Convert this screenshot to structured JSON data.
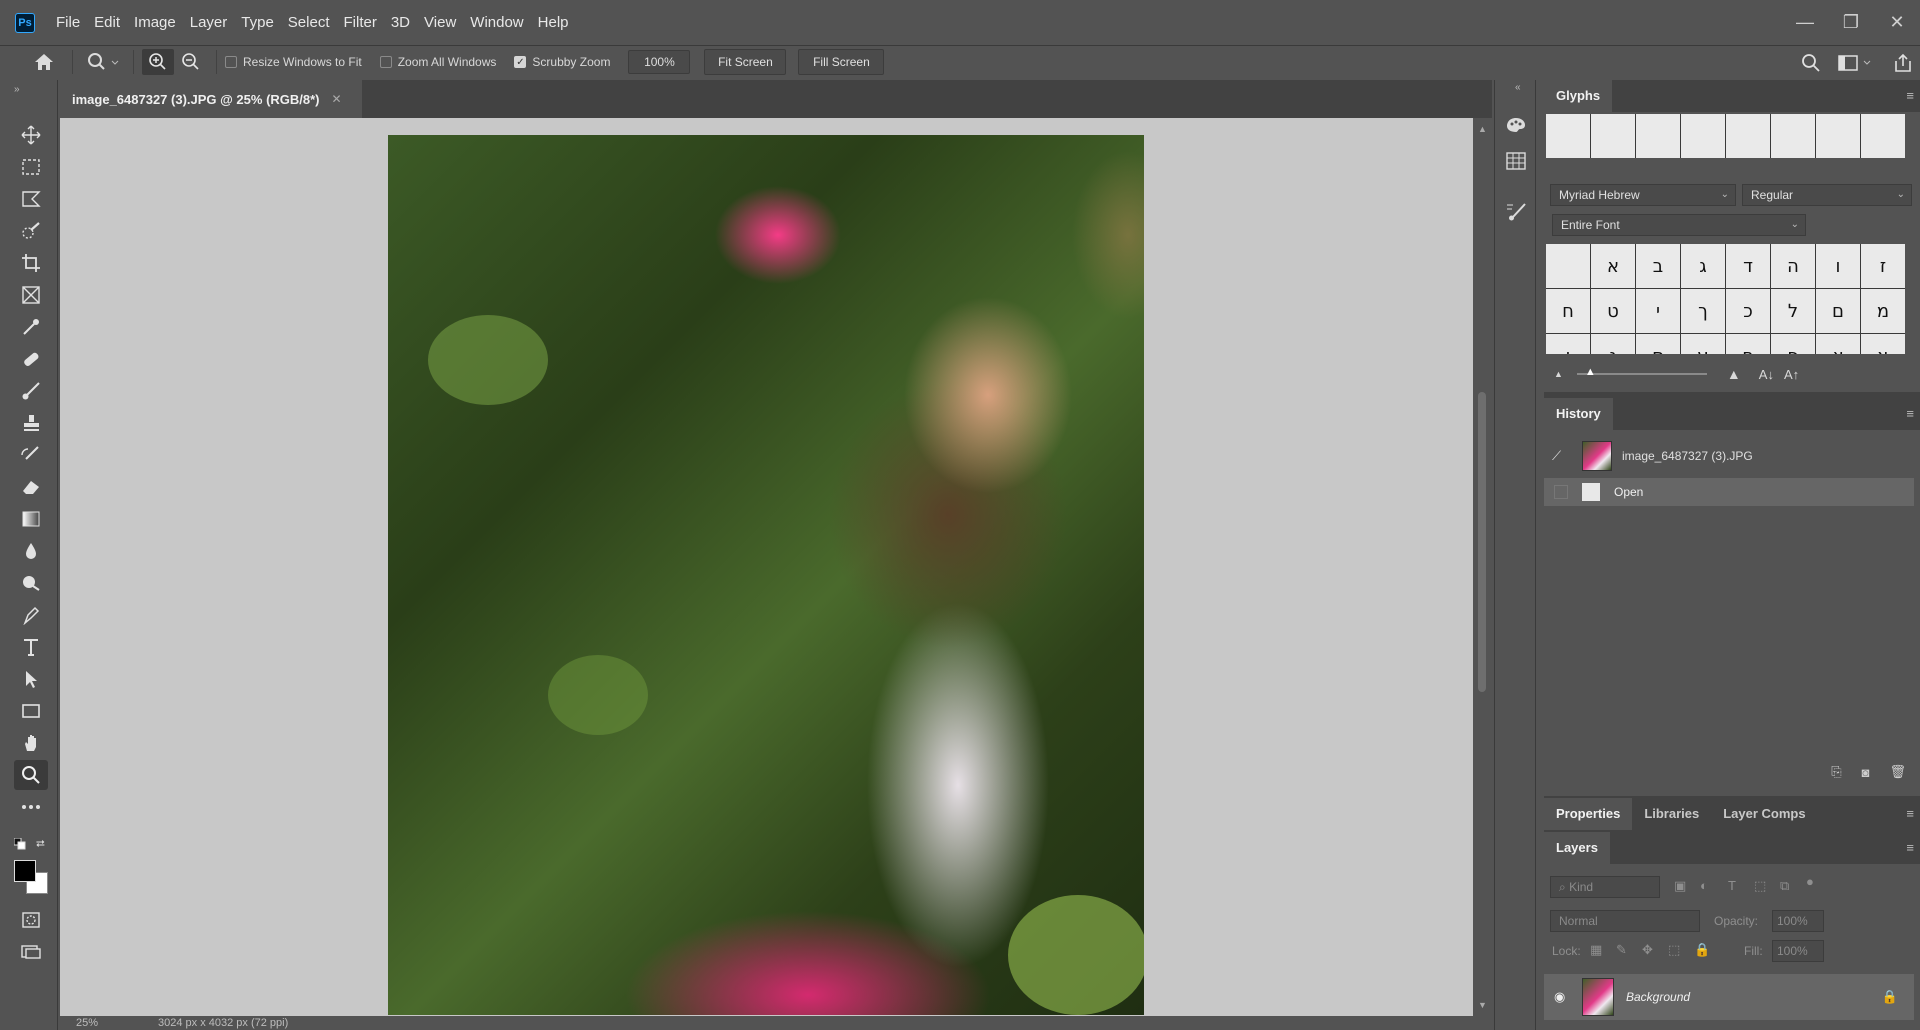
{
  "app": {
    "logo_text": "Ps",
    "menu": [
      "File",
      "Edit",
      "Image",
      "Layer",
      "Type",
      "Select",
      "Filter",
      "3D",
      "View",
      "Window",
      "Help"
    ]
  },
  "options": {
    "resize_windows_label": "Resize Windows to Fit",
    "resize_windows_checked": false,
    "zoom_all_label": "Zoom All Windows",
    "zoom_all_checked": false,
    "scrubby_zoom_label": "Scrubby Zoom",
    "scrubby_zoom_checked": true,
    "zoom_value": "100%",
    "fit_screen_label": "Fit Screen",
    "fill_screen_label": "Fill Screen"
  },
  "document": {
    "tab_title": "image_6487327 (3).JPG @ 25% (RGB/8*)",
    "zoom_status": "25%",
    "doc_size": "3024 px x 4032 px (72 ppi)"
  },
  "glyphs": {
    "tab_label": "Glyphs",
    "font_family": "Myriad Hebrew",
    "font_style": "Regular",
    "filter": "Entire Font",
    "rows": [
      [
        "",
        "א",
        "ב",
        "ג",
        "ד",
        "ה",
        "ו",
        "ז"
      ],
      [
        "ח",
        "ט",
        "י",
        "ך",
        "כ",
        "ל",
        "ם",
        "מ"
      ],
      [
        "ן",
        "נ",
        "ס",
        "ע",
        "ף",
        "פ",
        "ץ",
        "צ"
      ]
    ]
  },
  "history": {
    "tab_label": "History",
    "snapshot_label": "image_6487327 (3).JPG",
    "step_label": "Open"
  },
  "properties_group": {
    "tabs": [
      "Properties",
      "Libraries",
      "Layer Comps"
    ]
  },
  "layers": {
    "tab_label": "Layers",
    "kind_placeholder": "Kind",
    "blend_mode": "Normal",
    "opacity_label": "Opacity:",
    "opacity_value": "100%",
    "lock_label": "Lock:",
    "fill_label": "Fill:",
    "fill_value": "100%",
    "layer_name": "Background"
  }
}
